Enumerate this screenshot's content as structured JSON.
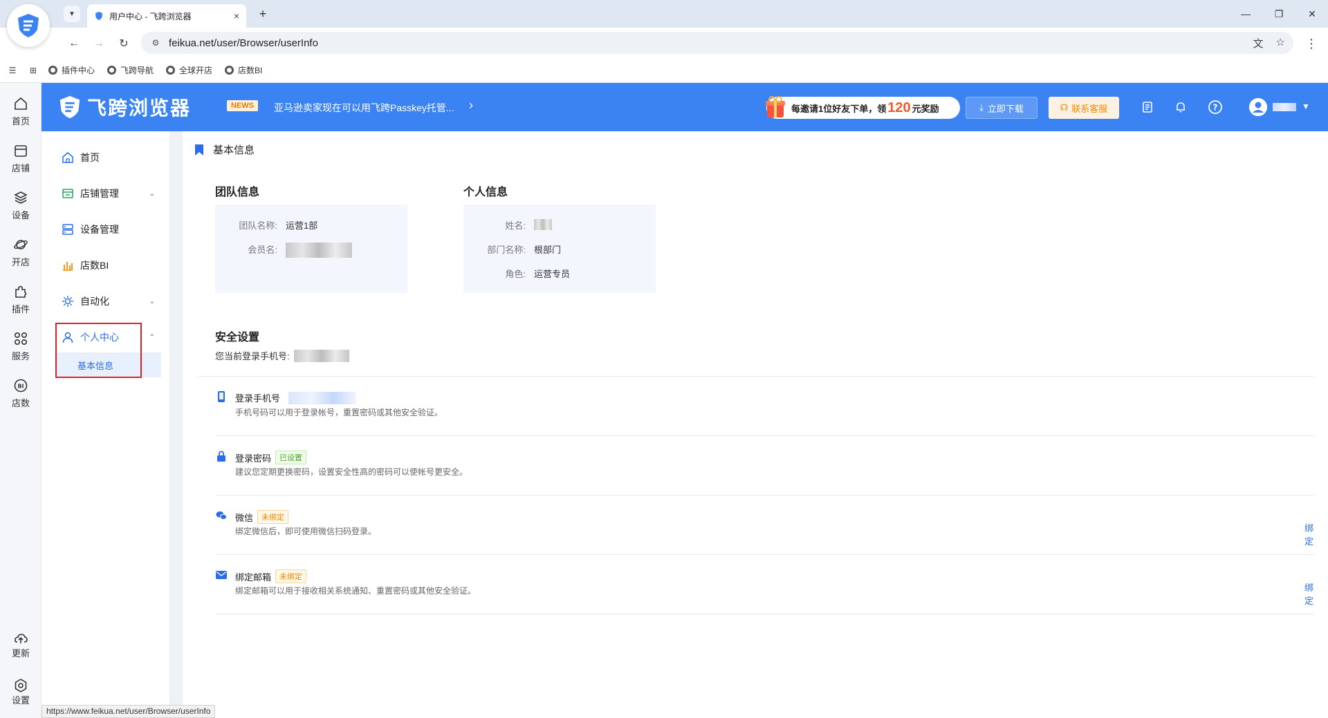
{
  "browser": {
    "tab_title": "用户中心 - 飞跨浏览器",
    "tab_close": "×",
    "new_tab": "+",
    "url": "feikua.net/user/Browser/userInfo",
    "bookmarks": [
      "插件中心",
      "飞跨导航",
      "全球开店",
      "店数BI"
    ],
    "status_url": "https://www.feikua.net/user/Browser/userInfo"
  },
  "rail": {
    "items": [
      "首页",
      "店铺",
      "设备",
      "开店",
      "插件",
      "服务",
      "店数"
    ],
    "bottom": [
      "更新",
      "设置"
    ]
  },
  "header": {
    "brand": "飞跨浏览器",
    "news_badge": "NEWS",
    "news_text": "亚马逊卖家现在可以用飞跨Passkey托管...",
    "invite_prefix": "每邀请1位好友下单，领",
    "invite_num": "120",
    "invite_suffix": "元奖励",
    "download": "立即下载",
    "contact": "联系客服"
  },
  "sidebar": {
    "items": [
      "首页",
      "店铺管理",
      "设备管理",
      "店数BI",
      "自动化",
      "个人中心"
    ],
    "submenu": "基本信息"
  },
  "page": {
    "title": "基本信息",
    "team": {
      "title": "团队信息",
      "name_label": "团队名称:",
      "name_value": "运营1部",
      "member_label": "会员名:"
    },
    "personal": {
      "title": "个人信息",
      "name_label": "姓名:",
      "dept_label": "部门名称:",
      "dept_value": "根部门",
      "role_label": "角色:",
      "role_value": "运营专员"
    },
    "security": {
      "title": "安全设置",
      "current_phone_label": "您当前登录手机号:",
      "items": [
        {
          "title": "登录手机号",
          "desc": "手机号码可以用于登录帐号，重置密码或其他安全验证。",
          "tag": "",
          "action": ""
        },
        {
          "title": "登录密码",
          "desc": "建议您定期更换密码，设置安全性高的密码可以使帐号更安全。",
          "tag": "已设置",
          "action": ""
        },
        {
          "title": "微信",
          "desc": "绑定微信后，即可使用微信扫码登录。",
          "tag": "未绑定",
          "action": "绑定"
        },
        {
          "title": "绑定邮箱",
          "desc": "绑定邮箱可以用于接收相关系统通知、重置密码或其他安全验证。",
          "tag": "未绑定",
          "action": "绑定"
        }
      ]
    }
  },
  "colors": {
    "brand_blue": "#3b82f2",
    "accent_orange": "#f08a00",
    "link_blue": "#2b6de6",
    "highlight_red": "#e02020"
  }
}
